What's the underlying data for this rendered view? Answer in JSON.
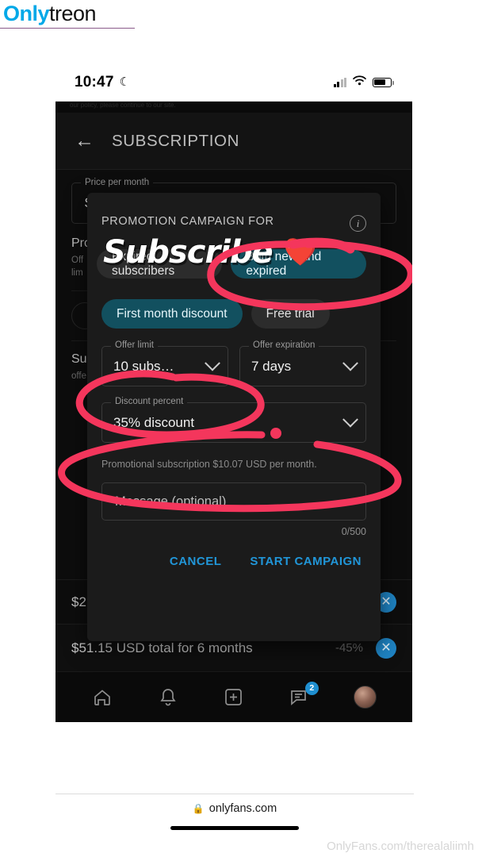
{
  "brand": {
    "part1": "Only",
    "part2": "treon"
  },
  "status_bar": {
    "time": "10:47",
    "moon_icon": "moon-icon",
    "signal_icon": "signal-bars-icon",
    "wifi_icon": "wifi-icon",
    "battery_icon": "battery-icon"
  },
  "app_header": {
    "back_icon": "back-arrow-icon",
    "title": "SUBSCRIPTION",
    "top_partial_text": "our policy, please continue to our site."
  },
  "background": {
    "price_field": {
      "legend": "Price per month",
      "value": "$15"
    },
    "promo_section": {
      "title": "Pro",
      "sub_line1": "Off",
      "sub_line2": "lim"
    },
    "subs_section": {
      "title": "Su",
      "sub_line1": "offe"
    },
    "bundle_row": {
      "price": "$2",
      "discount": "",
      "close_icon": "close-circle-icon"
    }
  },
  "modal": {
    "title": "PROMOTION CAMPAIGN FOR",
    "info_icon": "info-icon",
    "audience_tabs": [
      {
        "label": "Expired subscribers",
        "active": false
      },
      {
        "label": "Both new and expired",
        "active": true
      }
    ],
    "type_tabs": [
      {
        "label": "First month discount",
        "active": true
      },
      {
        "label": "Free trial",
        "active": false
      }
    ],
    "offer_limit": {
      "legend": "Offer limit",
      "value": "10 subs…",
      "caret_icon": "chevron-down-icon"
    },
    "offer_expiration": {
      "legend": "Offer expiration",
      "value": "7 days",
      "caret_icon": "chevron-down-icon"
    },
    "discount_percent": {
      "legend": "Discount percent",
      "value": "35% discount",
      "caret_icon": "chevron-down-icon"
    },
    "promo_note": "Promotional subscription $10.07 USD per month.",
    "message": {
      "placeholder": "Message (optional)",
      "counter": "0/500"
    },
    "cancel_label": "CANCEL",
    "start_label": "START CAMPAIGN"
  },
  "total_row": {
    "text": "$51.15 USD total for 6 months",
    "discount": "-45%",
    "close_icon": "close-circle-icon"
  },
  "bottom_nav": {
    "items": [
      {
        "name": "home-icon",
        "badge": ""
      },
      {
        "name": "bell-icon",
        "badge": ""
      },
      {
        "name": "plus-box-icon",
        "badge": ""
      },
      {
        "name": "messages-icon",
        "badge": "2"
      },
      {
        "name": "avatar",
        "badge": ""
      }
    ]
  },
  "overlay": {
    "word": "Subscribe",
    "heart": "❤️"
  },
  "footer": {
    "lock_icon": "lock-icon",
    "url": "onlyfans.com"
  },
  "watermark": "OnlyFans.com/therealaliimh",
  "colors": {
    "accent_blue": "#2196d8",
    "chip_active": "#12505f",
    "annotation_red": "#f4365c",
    "screen_bg": "#0d0d0d",
    "modal_bg": "#1b1b1b"
  }
}
